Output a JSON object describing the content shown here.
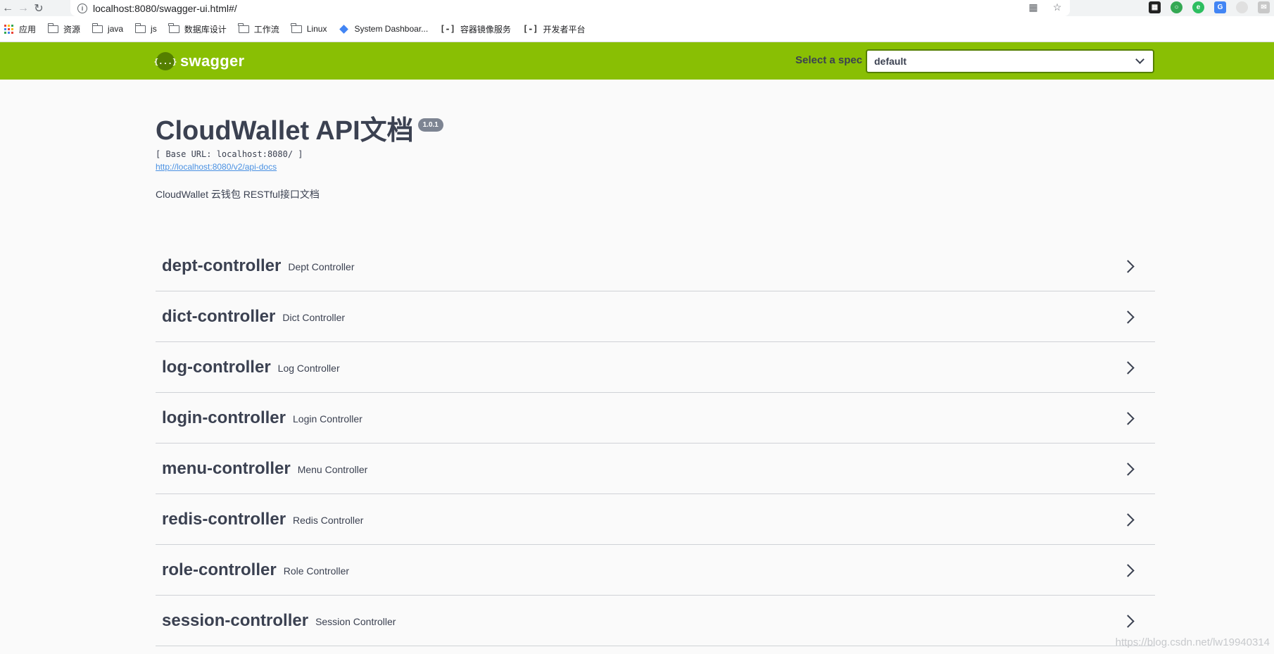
{
  "browser": {
    "url": "localhost:8080/swagger-ui.html#/",
    "bookmarks": [
      {
        "label": "应用",
        "icon": "apps-grid-icon"
      },
      {
        "label": "资源",
        "icon": "folder-icon"
      },
      {
        "label": "java",
        "icon": "folder-icon"
      },
      {
        "label": "js",
        "icon": "folder-icon"
      },
      {
        "label": "数据库设计",
        "icon": "folder-icon"
      },
      {
        "label": "工作流",
        "icon": "folder-icon"
      },
      {
        "label": "Linux",
        "icon": "folder-icon"
      },
      {
        "label": "System Dashboar...",
        "icon": "diamond-icon"
      },
      {
        "label": "容器镜像服务",
        "icon": "bracket-icon"
      },
      {
        "label": "开发者平台",
        "icon": "bracket-icon"
      }
    ]
  },
  "topbar": {
    "logo_text": "swagger",
    "logo_mark": "{...}",
    "spec_label": "Select a spec",
    "spec_value": "default",
    "brand_color": "#89bf04"
  },
  "info": {
    "title": "CloudWallet API文档",
    "version": "1.0.1",
    "base_url": "[ Base URL: localhost:8080/ ]",
    "api_docs_link": "http://localhost:8080/v2/api-docs",
    "description": "CloudWallet 云钱包 RESTful接口文档"
  },
  "controllers": [
    {
      "name": "dept-controller",
      "desc": "Dept Controller"
    },
    {
      "name": "dict-controller",
      "desc": "Dict Controller"
    },
    {
      "name": "log-controller",
      "desc": "Log Controller"
    },
    {
      "name": "login-controller",
      "desc": "Login Controller"
    },
    {
      "name": "menu-controller",
      "desc": "Menu Controller"
    },
    {
      "name": "redis-controller",
      "desc": "Redis Controller"
    },
    {
      "name": "role-controller",
      "desc": "Role Controller"
    },
    {
      "name": "session-controller",
      "desc": "Session Controller"
    }
  ],
  "watermark": "https://blog.csdn.net/lw19940314"
}
